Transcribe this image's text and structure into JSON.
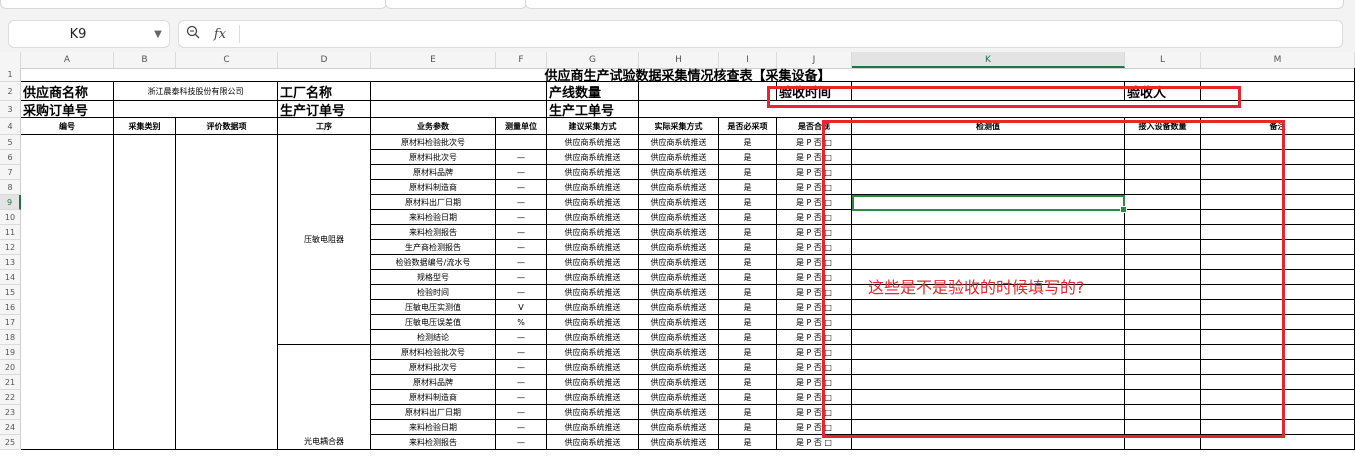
{
  "toolbar": {
    "cell_ref": "K9",
    "fx_label": "fx",
    "zoom_icon": "zoom-icon"
  },
  "columns": [
    "A",
    "B",
    "C",
    "D",
    "E",
    "F",
    "G",
    "H",
    "I",
    "J",
    "K",
    "L",
    "M"
  ],
  "rows": [
    "1",
    "2",
    "3",
    "4",
    "5",
    "6",
    "7",
    "8",
    "9",
    "10",
    "11",
    "12",
    "13",
    "14",
    "15",
    "16",
    "17",
    "18",
    "19",
    "20",
    "21",
    "22",
    "23",
    "24",
    "25"
  ],
  "title": "供应商生产试验数据采集情况核查表【采集设备】",
  "row2": {
    "supplier_label": "供应商名称",
    "supplier_value": "浙江晨泰科技股份有限公司",
    "factory_label": "工厂名称",
    "line_label": "产线数量",
    "accept_time_label": "验收时间",
    "accept_person_label": "验收人"
  },
  "row3": {
    "po_label": "采购订单号",
    "wo_label": "生产订单号",
    "prod_wo_label": "生产工单号"
  },
  "headers": [
    "编号",
    "采集类别",
    "评价数据项",
    "工序",
    "业务参数",
    "测量单位",
    "建议采集方式",
    "实际采集方式",
    "是否必采项",
    "是否合规",
    "检测值",
    "接入设备数量",
    "备注"
  ],
  "group1": "压敏电阻器",
  "group2": "光电耦合器",
  "data_rows": [
    {
      "param": "原材料检验批次号",
      "unit": "",
      "suggest": "供应商系统推送",
      "actual": "供应商系统推送",
      "must": "是",
      "ok": "是 P  否 □"
    },
    {
      "param": "原材料批次号",
      "unit": "—",
      "suggest": "供应商系统推送",
      "actual": "供应商系统推送",
      "must": "是",
      "ok": "是 P  否 □"
    },
    {
      "param": "原材料品牌",
      "unit": "—",
      "suggest": "供应商系统推送",
      "actual": "供应商系统推送",
      "must": "是",
      "ok": "是 P  否 □"
    },
    {
      "param": "原材料制造商",
      "unit": "—",
      "suggest": "供应商系统推送",
      "actual": "供应商系统推送",
      "must": "是",
      "ok": "是 P  否 □"
    },
    {
      "param": "原材料出厂日期",
      "unit": "—",
      "suggest": "供应商系统推送",
      "actual": "供应商系统推送",
      "must": "是",
      "ok": "是 P  否 □"
    },
    {
      "param": "来料检验日期",
      "unit": "—",
      "suggest": "供应商系统推送",
      "actual": "供应商系统推送",
      "must": "是",
      "ok": "是 P  否 □"
    },
    {
      "param": "来料检测报告",
      "unit": "—",
      "suggest": "供应商系统推送",
      "actual": "供应商系统推送",
      "must": "是",
      "ok": "是 P  否 □"
    },
    {
      "param": "生产商检测报告",
      "unit": "—",
      "suggest": "供应商系统推送",
      "actual": "供应商系统推送",
      "must": "是",
      "ok": "是 P  否 □"
    },
    {
      "param": "检验数据编号/流水号",
      "unit": "—",
      "suggest": "供应商系统推送",
      "actual": "供应商系统推送",
      "must": "是",
      "ok": "是 P  否 □"
    },
    {
      "param": "规格型号",
      "unit": "—",
      "suggest": "供应商系统推送",
      "actual": "供应商系统推送",
      "must": "是",
      "ok": "是 P  否 □"
    },
    {
      "param": "检验时间",
      "unit": "—",
      "suggest": "供应商系统推送",
      "actual": "供应商系统推送",
      "must": "是",
      "ok": "是 P  否 □"
    },
    {
      "param": "压敏电压实测值",
      "unit": "V",
      "suggest": "供应商系统推送",
      "actual": "供应商系统推送",
      "must": "是",
      "ok": "是 P  否 □"
    },
    {
      "param": "压敏电压误差值",
      "unit": "%",
      "suggest": "供应商系统推送",
      "actual": "供应商系统推送",
      "must": "是",
      "ok": "是 P  否 □"
    },
    {
      "param": "检测结论",
      "unit": "—",
      "suggest": "供应商系统推送",
      "actual": "供应商系统推送",
      "must": "是",
      "ok": "是 P  否 □"
    },
    {
      "param": "原材料检验批次号",
      "unit": "—",
      "suggest": "供应商系统推送",
      "actual": "供应商系统推送",
      "must": "是",
      "ok": "是 P  否 □"
    },
    {
      "param": "原材料批次号",
      "unit": "—",
      "suggest": "供应商系统推送",
      "actual": "供应商系统推送",
      "must": "是",
      "ok": "是 P  否 □"
    },
    {
      "param": "原材料品牌",
      "unit": "—",
      "suggest": "供应商系统推送",
      "actual": "供应商系统推送",
      "must": "是",
      "ok": "是 P  否 □"
    },
    {
      "param": "原材料制造商",
      "unit": "—",
      "suggest": "供应商系统推送",
      "actual": "供应商系统推送",
      "must": "是",
      "ok": "是 P  否 □"
    },
    {
      "param": "原材料出厂日期",
      "unit": "—",
      "suggest": "供应商系统推送",
      "actual": "供应商系统推送",
      "must": "是",
      "ok": "是 P  否 □"
    },
    {
      "param": "来料检验日期",
      "unit": "—",
      "suggest": "供应商系统推送",
      "actual": "供应商系统推送",
      "must": "是",
      "ok": "是 P  否 □"
    },
    {
      "param": "来料检测报告",
      "unit": "—",
      "suggest": "供应商系统推送",
      "actual": "供应商系统推送",
      "must": "是",
      "ok": "是 P  否 □"
    }
  ],
  "annotation": "这些是不是验收的时候填写的?",
  "colors": {
    "selection": "#2b8a3e",
    "annotation": "#e8262b"
  }
}
